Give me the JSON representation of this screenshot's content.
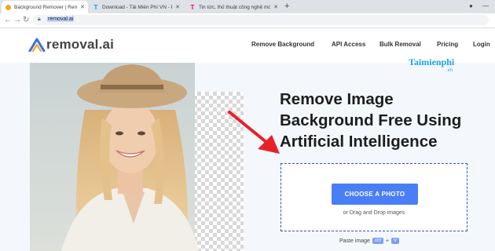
{
  "browser": {
    "tabs": [
      {
        "title": "Background Remover | Remove B",
        "favicon": "removal-favicon"
      },
      {
        "title": "Download - Tải Miễn Phí VN - P",
        "favicon": "T"
      },
      {
        "title": "Tin tức, thủ thuật công nghệ mới",
        "favicon": "T"
      }
    ],
    "new_tab": "+",
    "address": "removal.ai"
  },
  "site": {
    "logo": "removal.ai",
    "nav": [
      "Remove Background",
      "API Access",
      "Bulk Removal",
      "Pricing",
      "Login"
    ]
  },
  "watermark": {
    "brand": "Taimienphi",
    "suffix": ".vn"
  },
  "hero": {
    "headline_lines": [
      "Remove Image",
      "Background Free Using",
      "Artificial Intelligence"
    ],
    "choose_button": "CHOOSE A PHOTO",
    "drag_text": "or Drag and Drop images",
    "paste_label": "Paste image",
    "paste_keys": [
      "ctrl",
      "+",
      "V"
    ]
  },
  "colors": {
    "accent": "#4a7ef6",
    "dropzone_border": "#2f4fd6",
    "arrow": "#e8202a"
  }
}
